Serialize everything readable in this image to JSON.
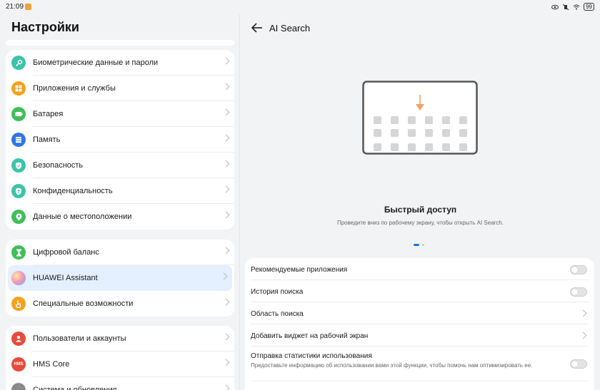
{
  "status_bar": {
    "time": "21:09",
    "battery": "99"
  },
  "settings": {
    "title": "Настройки",
    "group1": [
      {
        "label": "Биометрические данные и пароли",
        "icon": "key-icon",
        "color": "#3cc3a8"
      },
      {
        "label": "Приложения и службы",
        "icon": "apps-grid-icon",
        "color": "#f3a21c"
      },
      {
        "label": "Батарея",
        "icon": "battery-icon",
        "color": "#3fbf59"
      },
      {
        "label": "Память",
        "icon": "storage-icon",
        "color": "#2f76e6"
      },
      {
        "label": "Безопасность",
        "icon": "shield-icon",
        "color": "#3cc3a8"
      },
      {
        "label": "Конфиденциальность",
        "icon": "privacy-icon",
        "color": "#3cc3a8"
      },
      {
        "label": "Данные о местоположении",
        "icon": "location-pin-icon",
        "color": "#3fbf59"
      }
    ],
    "group2": [
      {
        "label": "Цифровой баланс",
        "icon": "hourglass-icon",
        "color": "#3fbf59"
      },
      {
        "label": "HUAWEI Assistant",
        "icon": "assistant-orb-icon",
        "color": "#c78ce8"
      },
      {
        "label": "Специальные возможности",
        "icon": "hand-icon",
        "color": "#f3a21c"
      }
    ],
    "group3": [
      {
        "label": "Пользователи и аккаунты",
        "icon": "user-icon",
        "color": "#e84a3c"
      },
      {
        "label": "HMS Core",
        "icon": "hms-icon",
        "color": "#e84a3c",
        "badge": "HMS"
      },
      {
        "label": "Система и обновления",
        "icon": "system-icon",
        "color": "#8a8a8a"
      }
    ]
  },
  "ai_search": {
    "title": "AI Search",
    "feature_title": "Быстрый доступ",
    "feature_subtitle": "Проведите вниз по рабочему экрану, чтобы открыть AI Search.",
    "rows": {
      "recommended": "Рекомендуемые приложения",
      "history": "История поиска",
      "scope": "Область поиска",
      "widget": "Добавить виджет на рабочий экран",
      "stats": "Отправка статистики использования",
      "stats_sub": "Предоставьте информацию об использовании вами этой функции, чтобы помочь нам оптимизировать ее."
    }
  },
  "colors": {
    "accent": "#1a6fe8",
    "illustration_arrow": "#f2a262"
  }
}
